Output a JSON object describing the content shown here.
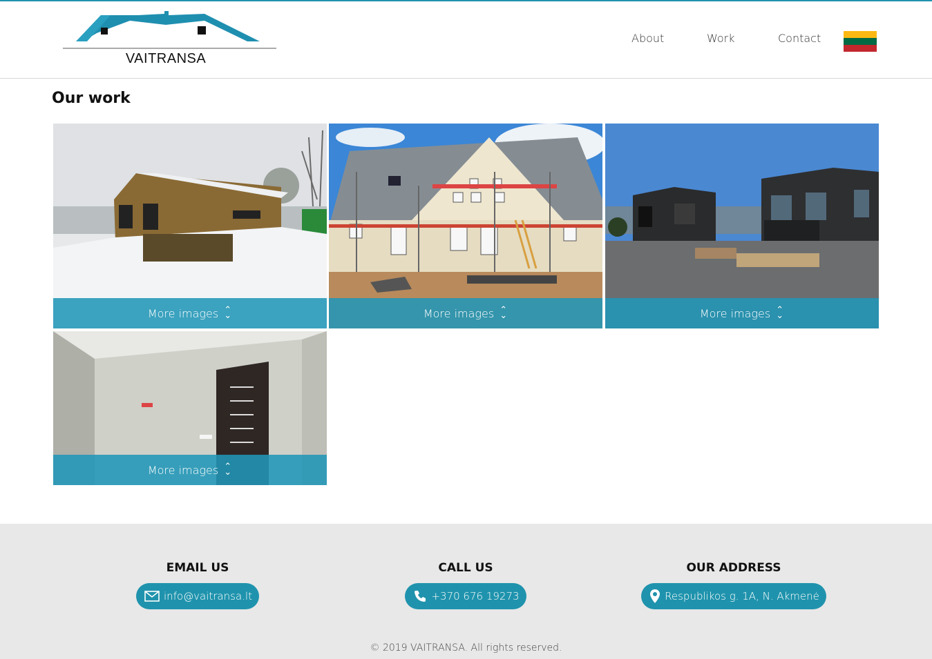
{
  "header": {
    "logo_text": "VAITRANSA",
    "nav": [
      {
        "label": "About"
      },
      {
        "label": "Work"
      },
      {
        "label": "Contact"
      }
    ],
    "language_flag": "lt-flag-icon",
    "flag_colors": [
      "#fdb913",
      "#006a44",
      "#c1272d"
    ]
  },
  "main": {
    "title": "Our work",
    "cards": [
      {
        "button_label": "More images",
        "photo": "snowy wooden house"
      },
      {
        "button_label": "More images",
        "photo": "house with scaffolding"
      },
      {
        "button_label": "More images",
        "photo": "dark modern houses"
      },
      {
        "button_label": "More images",
        "photo": "interior room with door"
      }
    ]
  },
  "footer": {
    "email": {
      "heading": "EMAIL US",
      "value": "info@vaitransa.lt",
      "icon": "mail-icon"
    },
    "phone": {
      "heading": "CALL US",
      "value": "+370 676 19273",
      "icon": "phone-icon"
    },
    "address": {
      "heading": "OUR ADDRESS",
      "value": "Respublikos g. 1A, N. Akmenė",
      "icon": "location-pin-icon"
    },
    "copyright": "© 2019 VAITRANSA. All rights reserved."
  },
  "colors": {
    "accent": "#1f93ad",
    "footer_bg": "#e8e8e8"
  }
}
